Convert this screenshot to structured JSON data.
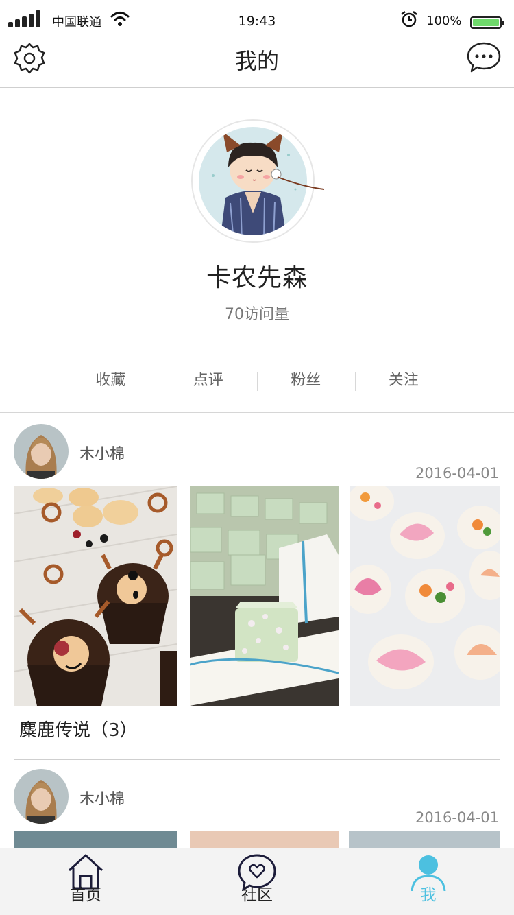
{
  "status_bar": {
    "carrier": "中国联通",
    "time": "19:43",
    "battery": "100%",
    "icons": [
      "signal-icon",
      "wifi-icon",
      "alarm-icon",
      "battery-icon"
    ]
  },
  "nav": {
    "title": "我的",
    "left_icon": "settings-icon",
    "right_icon": "message-icon"
  },
  "profile": {
    "name": "卡农先森",
    "visits": "70访问量"
  },
  "stats": [
    {
      "label": "收藏"
    },
    {
      "label": "点评"
    },
    {
      "label": "粉丝"
    },
    {
      "label": "关注"
    }
  ],
  "posts": [
    {
      "user": "木小棉",
      "date": "2016-04-01",
      "caption": "麋鹿传说（3）"
    },
    {
      "user": "木小棉",
      "date": "2016-04-01",
      "caption": ""
    }
  ],
  "tabbar": {
    "tabs": [
      {
        "label": "首页",
        "icon": "home-icon"
      },
      {
        "label": "社区",
        "icon": "community-icon"
      },
      {
        "label": "我",
        "icon": "profile-icon"
      }
    ],
    "active_color": "#4cc0e0"
  }
}
